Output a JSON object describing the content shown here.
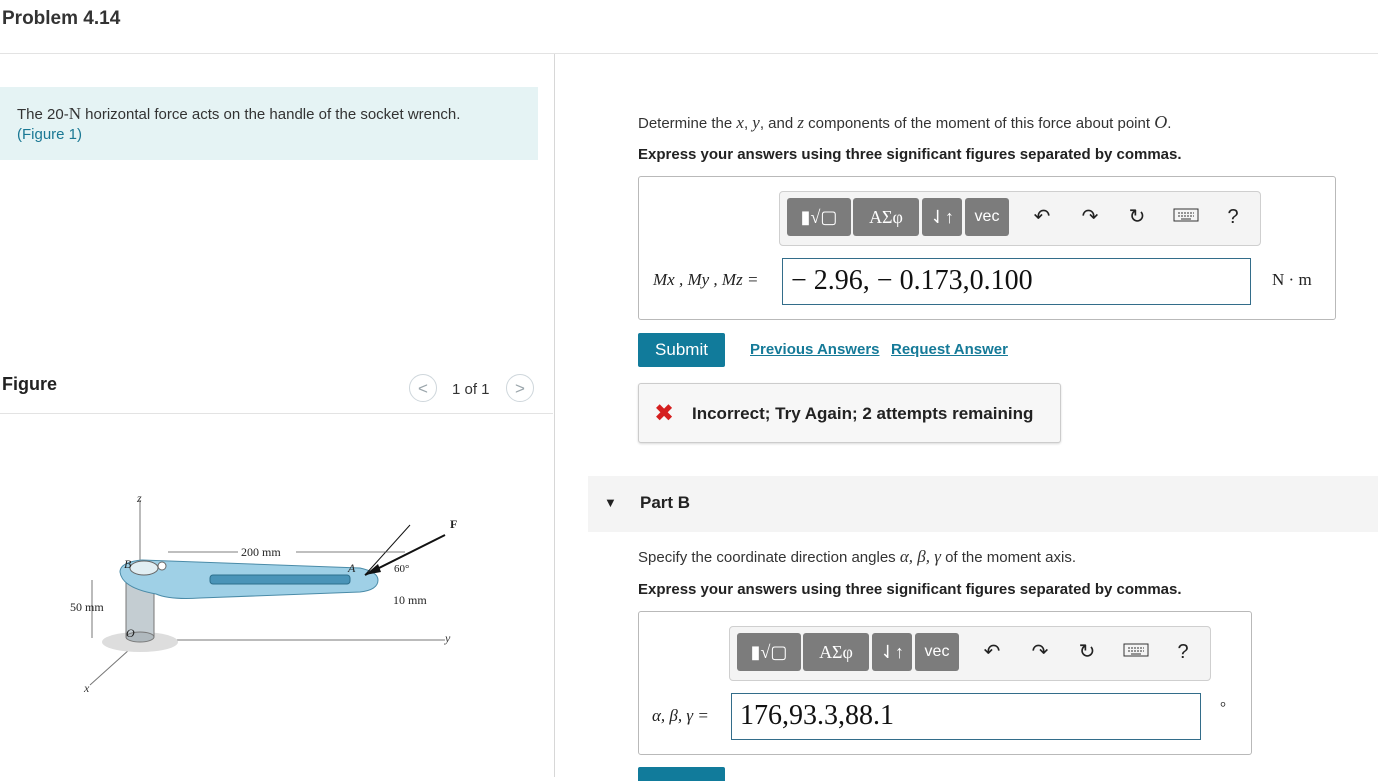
{
  "header": {
    "title": "Problem 4.14"
  },
  "intro": {
    "text_pre": "The 20-",
    "text_unit": "N",
    "text_post": " horizontal force acts on the handle of the socket wrench.",
    "figure_link": "(Figure 1)"
  },
  "figure_panel": {
    "title": "Figure",
    "pager_label": "1 of 1",
    "prev_symbol": "<",
    "next_symbol": ">",
    "labels": {
      "z": "z",
      "y": "y",
      "x": "x",
      "F": "F",
      "A": "A",
      "B": "B",
      "O": "O",
      "dim_200": "200 mm",
      "dim_50": "50 mm",
      "dim_10": "10 mm",
      "angle": "60°"
    }
  },
  "part_a": {
    "question_pre": "Determine the ",
    "var_x": "x",
    "sep1": ", ",
    "var_y": "y",
    "sep2": ", and ",
    "var_z": "z",
    "question_post": " components of the moment of this force about point ",
    "point": "O",
    "period": ".",
    "instruction": "Express your answers using three significant figures separated by commas.",
    "toolbar": {
      "templates": "▮√▢",
      "greek": "ΑΣφ",
      "arrows": "⇃↑",
      "vec": "vec",
      "help": "?"
    },
    "answer_label": "Mx , My , Mz =",
    "answer_value": "− 2.96, − 0.173,0.100",
    "unit": "N · m",
    "submit_label": "Submit",
    "previous_answers": "Previous Answers",
    "request_answer": "Request Answer",
    "feedback_icon": "✖",
    "feedback_text": "Incorrect; Try Again; 2 attempts remaining"
  },
  "part_b": {
    "caret": "▼",
    "title": "Part B",
    "question_pre": "Specify the coordinate direction angles ",
    "greek_angles": "α, β, γ",
    "question_post": " of the moment axis.",
    "instruction": "Express your answers using three significant figures separated by commas.",
    "toolbar": {
      "templates": "▮√▢",
      "greek": "ΑΣφ",
      "arrows": "⇃↑",
      "vec": "vec",
      "help": "?"
    },
    "answer_label": "α, β, γ =",
    "answer_value": "176,93.3,88.1",
    "unit": "°"
  },
  "colors": {
    "accent": "#117b9b",
    "intro_bg": "#e5f3f4",
    "error": "#d51f1f"
  },
  "icons": [
    "undo-icon",
    "redo-icon",
    "reset-icon",
    "keyboard-icon",
    "help-icon"
  ]
}
